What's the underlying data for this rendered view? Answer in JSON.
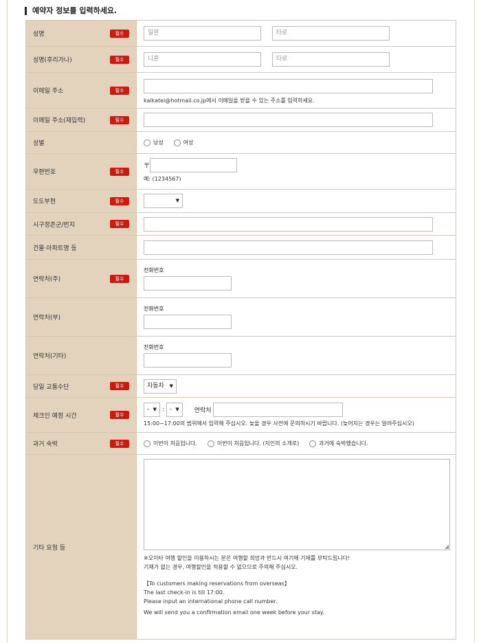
{
  "section_title": "예약자 정보를 입력하세요.",
  "required_badge": "필수",
  "name": {
    "label": "성명",
    "first_placeholder": "일본",
    "last_placeholder": "타로"
  },
  "name_kana": {
    "label": "성명(후리가나)",
    "first_placeholder": "니혼",
    "last_placeholder": "타로"
  },
  "email": {
    "label": "이메일 주소",
    "note": "kaikatei@hotmail.co.jp에서 이메일을 받을 수 있는 주소를 입력하세요."
  },
  "email_confirm": {
    "label": "이메일 주소(재입력)"
  },
  "gender": {
    "label": "성별",
    "options": [
      "남성",
      "여성"
    ]
  },
  "postal": {
    "label": "우편번호",
    "mark": "〒",
    "example": "예: (1234567)"
  },
  "prefecture": {
    "label": "도도부현",
    "value": ""
  },
  "city": {
    "label": "시구정촌군/번지"
  },
  "building": {
    "label": "건물·아파트명 등"
  },
  "contact_main": {
    "label": "연락처(주)",
    "sub_label": "전화번호"
  },
  "contact_sub": {
    "label": "연락처(부)",
    "sub_label": "전화번호"
  },
  "contact_other": {
    "label": "연락처(기타)",
    "sub_label": "전화번호"
  },
  "transport": {
    "label": "당일 교통수단",
    "value": "자동차"
  },
  "checkin": {
    "label": "체크인 예정 시간",
    "hour_value": "-",
    "minute_value": "-",
    "separator": ":",
    "contact_label": "연락처",
    "note": "15:00~17:00의 범위에서 입력해 주십시오. 늦을 경우 사전에 문의하시기 바랍니다. (늦어지는 경우는 알려주십시오)"
  },
  "past_stay": {
    "label": "과거 숙박",
    "options": [
      "이번이 처음입니다.",
      "이번이 처음입니다. (지인의 소개로)",
      "과거에 숙박했습니다."
    ]
  },
  "other_requests": {
    "label": "기타 요청 등",
    "notes": [
      "※오이타 여행 할인을 이용하시는 분은 여행할 희망과 반드시 여기에 기재를 부탁드립니다!",
      "기재가 없는 경우, 여행할인을 적용할 수 없으므로 주의해 주십시오.",
      "【To customers making reservations from overseas】",
      "The last check-in is till 17:00.",
      "Please input an international phone call number.",
      "We will send you a confirmation email one week before your stay."
    ]
  },
  "icons": {
    "dropdown": "chevron-down-icon",
    "resize": "resize-grip-icon"
  }
}
